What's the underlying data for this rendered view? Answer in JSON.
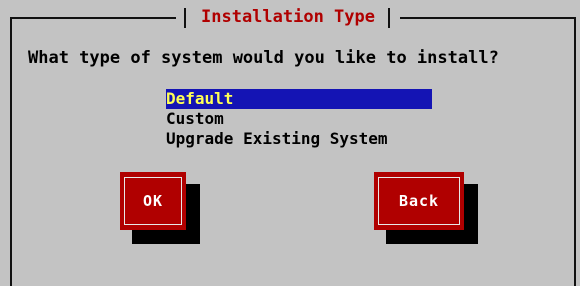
{
  "dialog": {
    "title": "Installation Type",
    "question": "What type of system would you like to install?"
  },
  "options": {
    "items": [
      {
        "label": "Default",
        "selected": true
      },
      {
        "label": "Custom",
        "selected": false
      },
      {
        "label": "Upgrade Existing System",
        "selected": false
      }
    ]
  },
  "buttons": {
    "ok_label": "OK",
    "back_label": "Back"
  },
  "colors": {
    "background": "#c3c3c3",
    "title_text": "#b00000",
    "selection_bg": "#1414b4",
    "selection_text": "#ffff55",
    "button_bg": "#b00000",
    "button_text": "#ffffff"
  }
}
